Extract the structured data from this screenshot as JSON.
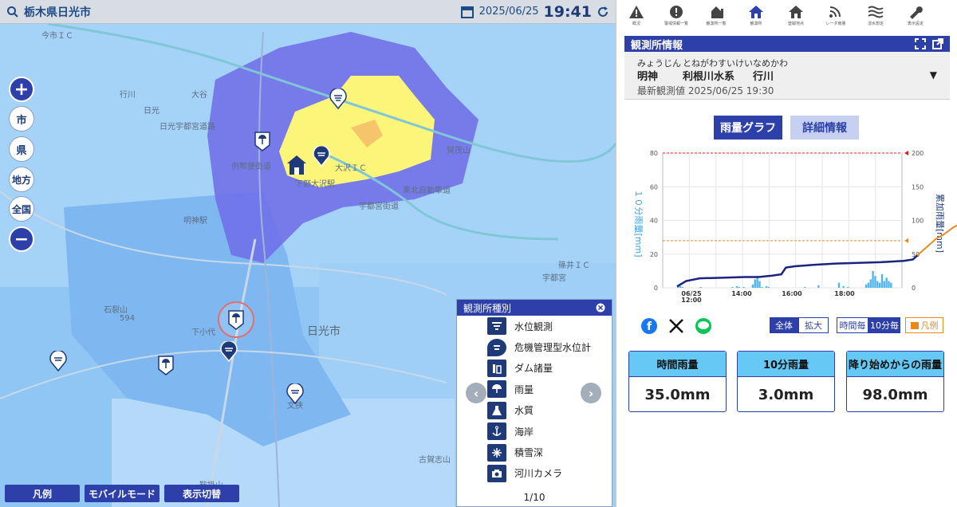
{
  "topbar": {
    "location": "栃木県日光市",
    "date": "2025/06/25",
    "time": "19:41"
  },
  "map_controls": {
    "city": "市",
    "pref": "県",
    "region": "地方",
    "nation": "全国"
  },
  "map_labels": {
    "city_name": "日光市",
    "ic1": "今市ＩＣ",
    "ic2": "大沢ＩＣ",
    "station": "下野大沢駅",
    "meijin_station": "明神駅",
    "place1": "石裂山",
    "place2": "594",
    "place3": "下小代",
    "place4": "古賀志山",
    "place5": "鞍掛山",
    "place6": "篠井ＩＣ",
    "place7": "宇都宮",
    "place8": "日光宇都宮道路",
    "place9": "例幣使街道",
    "place10": "行川",
    "place11": "文挟",
    "place12": "東北自動車道",
    "place13": "賀茂山",
    "place14": "大谷",
    "place15": "日光",
    "place16": "宇都宮街道"
  },
  "bottom_buttons": {
    "legend": "凡例",
    "mobile": "モバイルモード",
    "display": "表示切替"
  },
  "legend_popup": {
    "title": "観測所種別",
    "items": [
      "水位観測",
      "危機管理型水位計",
      "ダム諸量",
      "雨量",
      "水質",
      "海岸",
      "積雪深",
      "河川カメラ"
    ],
    "pager": "1/10"
  },
  "iconbar": [
    {
      "icon": "warning-icon",
      "label": "概況"
    },
    {
      "icon": "alert-icon",
      "label": "警戒情報一覧"
    },
    {
      "icon": "stations-icon",
      "label": "観測所一覧"
    },
    {
      "icon": "home-icon",
      "label": "観測所"
    },
    {
      "icon": "house-icon",
      "label": "登録地点"
    },
    {
      "icon": "rss-icon",
      "label": "レーダ雨量"
    },
    {
      "icon": "wave-icon",
      "label": "浸水想定"
    },
    {
      "icon": "wrench-icon",
      "label": "表示設定"
    }
  ],
  "panel": {
    "title": "観測所情報",
    "station": {
      "ruby1": "みょうじん",
      "name1": "明神",
      "ruby2": "とねがわすいけい",
      "name2": "利根川水系",
      "ruby3": "なめかわ",
      "name3": "行川"
    },
    "latest": "最新観測値 2025/06/25 19:30",
    "tab_graph": "雨量グラフ",
    "tab_detail": "詳細情報"
  },
  "chart_data": {
    "type": "bar+line",
    "x_ticks": [
      "06/25 12:00",
      "14:00",
      "16:00",
      "18:00"
    ],
    "y_left_label": "１０分雨量[mm]",
    "y_left_ticks": [
      0,
      20,
      40,
      60,
      80
    ],
    "y_left_lim": [
      0,
      80
    ],
    "y_right_label": "累加雨量[mm]",
    "y_right_ticks": [
      0,
      50,
      100,
      150,
      200
    ],
    "y_right_lim": [
      0,
      200
    ],
    "bars_10min": [
      1.5,
      1,
      0.5,
      0,
      0,
      0,
      0,
      0,
      0,
      0,
      0.5,
      0,
      0,
      0,
      0,
      0,
      0,
      0,
      0,
      0,
      0,
      0,
      0,
      0,
      0.5,
      0,
      1,
      0.5,
      0,
      0.5,
      0,
      0,
      0,
      2,
      5,
      7,
      4,
      0.5,
      0,
      1,
      0.5,
      0,
      0,
      0,
      0,
      0,
      0,
      0,
      0,
      0,
      0,
      0,
      0,
      0,
      0,
      0,
      0.5,
      0,
      0,
      0,
      0,
      0,
      1.5,
      0,
      0,
      0,
      0,
      0,
      0,
      0,
      0,
      3,
      0,
      1,
      0,
      0.5,
      0,
      0,
      0,
      0,
      0,
      0,
      0,
      2,
      3,
      5,
      10,
      7,
      4,
      3,
      8,
      4,
      6,
      4,
      3
    ],
    "cumulative": [
      [
        0,
        2
      ],
      [
        4,
        10
      ],
      [
        10,
        14
      ],
      [
        20,
        15
      ],
      [
        30,
        16
      ],
      [
        36,
        16
      ],
      [
        42,
        18
      ],
      [
        46,
        20
      ],
      [
        48,
        30
      ],
      [
        52,
        32
      ],
      [
        60,
        34
      ],
      [
        70,
        36
      ],
      [
        80,
        37
      ],
      [
        90,
        38
      ],
      [
        100,
        40
      ],
      [
        104,
        42
      ],
      [
        106,
        48
      ]
    ],
    "cumulative_recent": [
      [
        106,
        48
      ],
      [
        110,
        60
      ],
      [
        114,
        72
      ],
      [
        118,
        80
      ],
      [
        122,
        90
      ],
      [
        126,
        97
      ],
      [
        128,
        98
      ]
    ],
    "warn_left": 80,
    "warn_right": 70
  },
  "toggles": {
    "all": "全体",
    "zoom": "拡大",
    "hourly": "時間毎",
    "tenmin": "10分毎",
    "legend": "凡例"
  },
  "stats": [
    {
      "label": "時間雨量",
      "value": "35.0mm"
    },
    {
      "label": "10分雨量",
      "value": "3.0mm"
    },
    {
      "label": "降り始めからの雨量",
      "value": "98.0mm"
    }
  ],
  "colors": {
    "accent": "#2d3fa8",
    "stat_header": "#66c8f4",
    "rain_yellow": "#fbf57a",
    "rain_purple": "#6e6ce8"
  }
}
